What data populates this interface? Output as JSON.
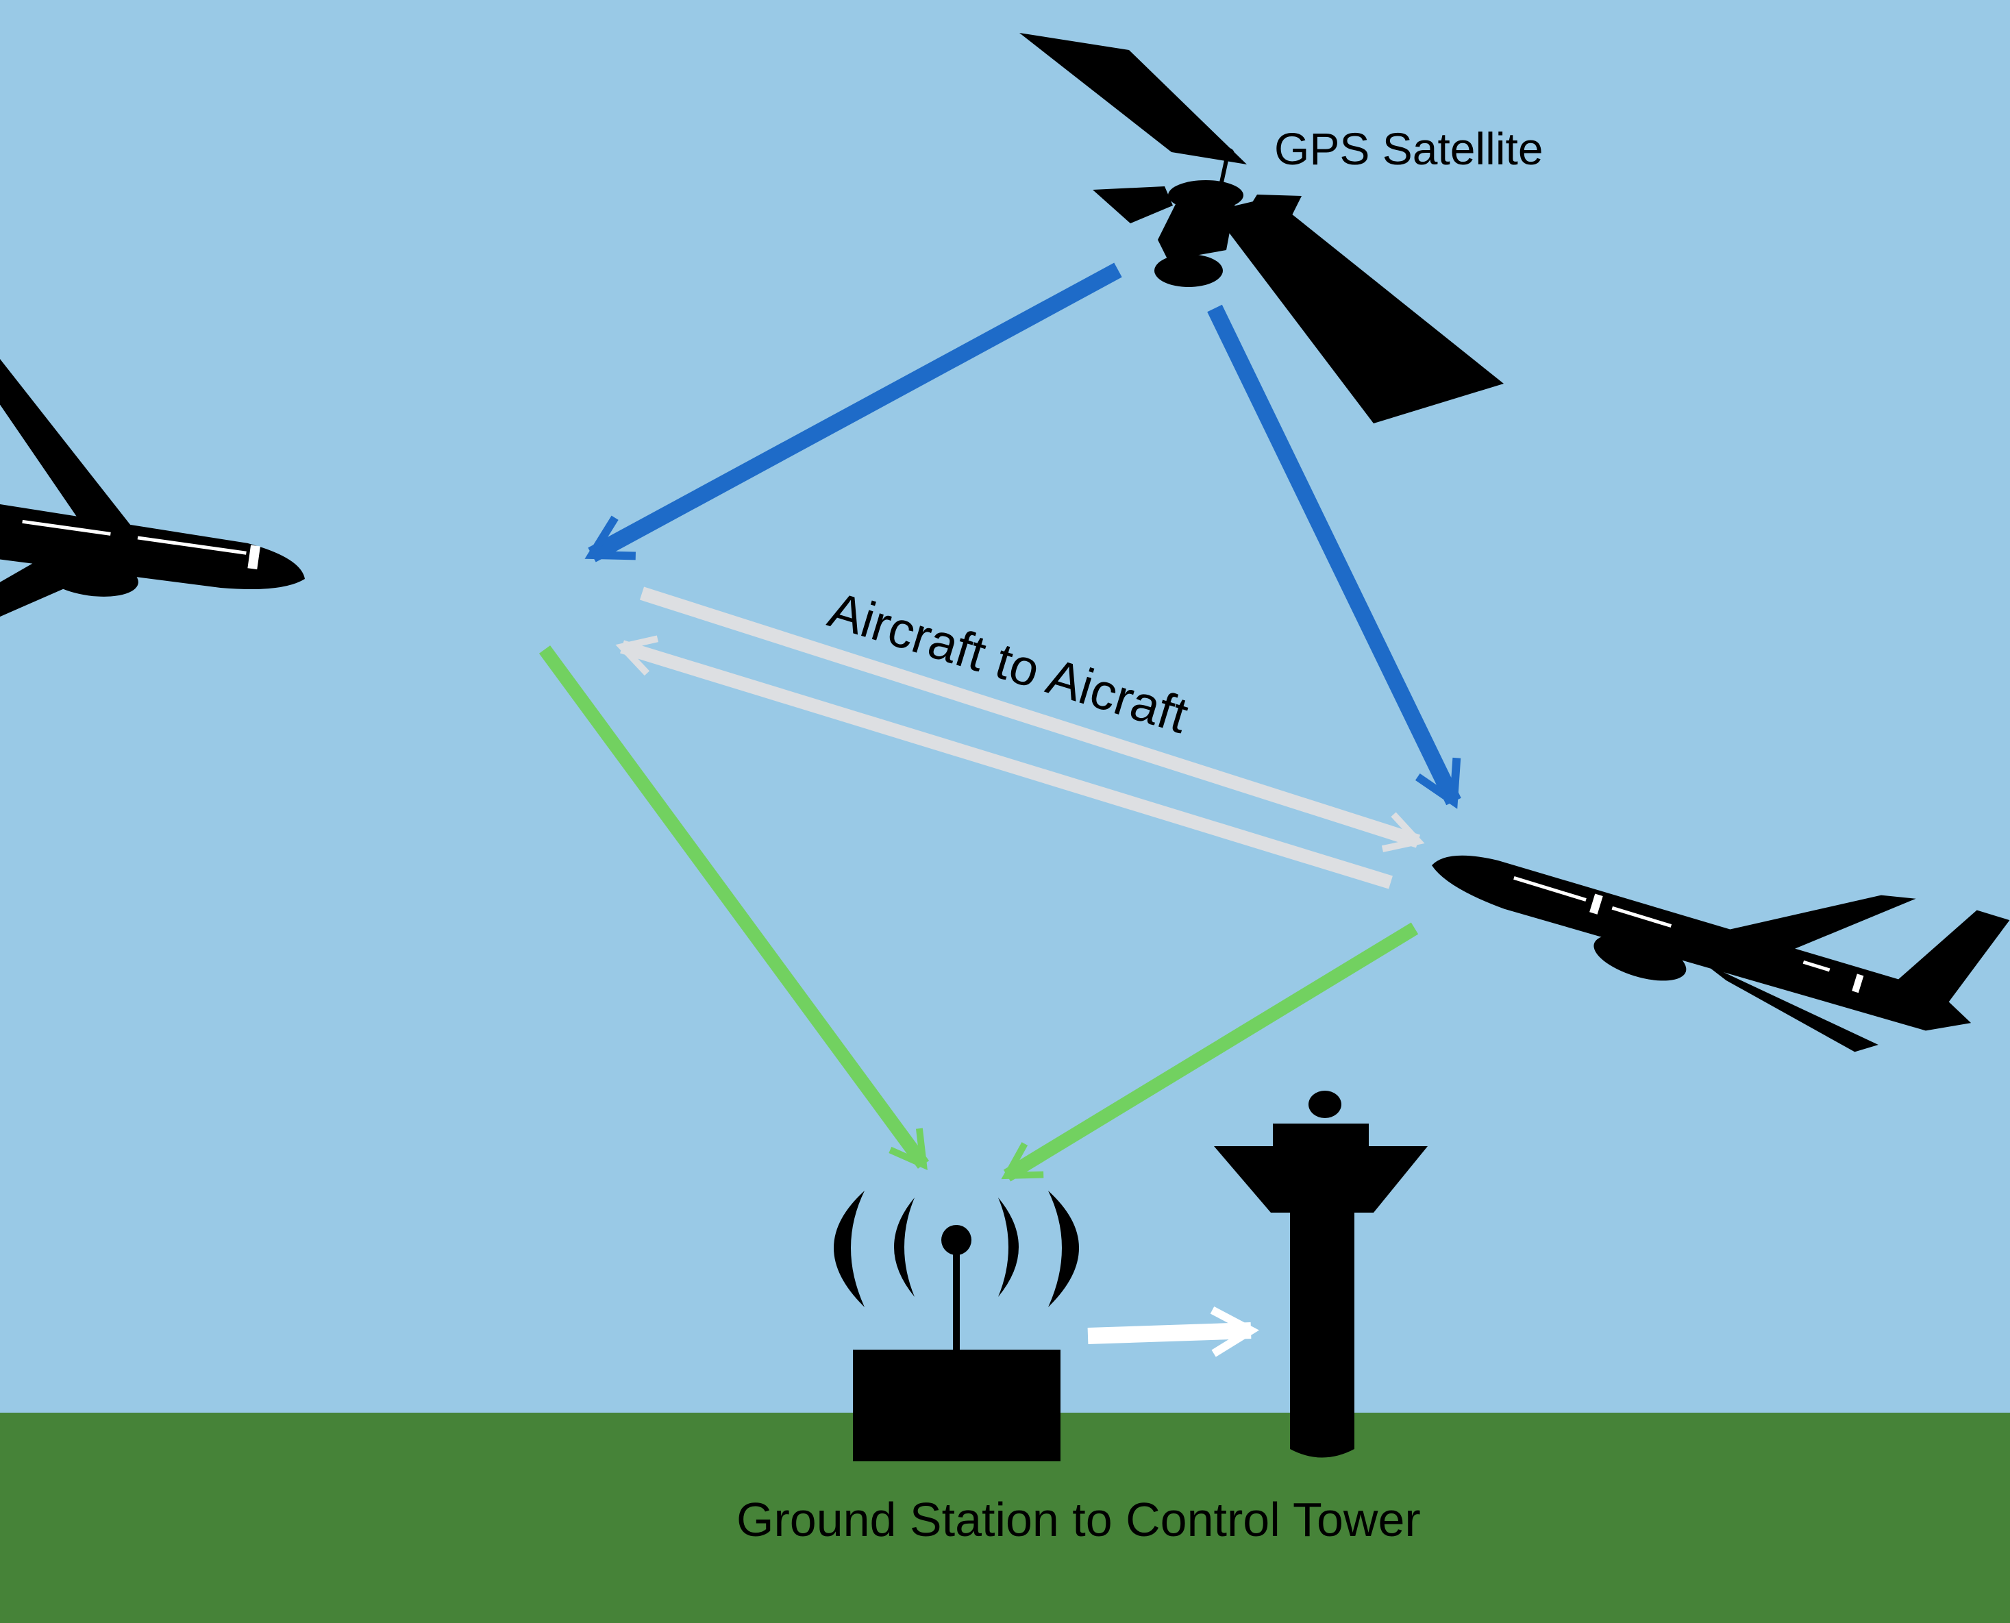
{
  "labels": {
    "satellite": "GPS Satellite",
    "aircraft_link": "Aircraft to Aicraft",
    "ground_link": "Ground Station to Control Tower"
  },
  "colors": {
    "sky": "#99c9e6",
    "ground": "#468338",
    "gps_link": "#1e6bc8",
    "aircraft_link": "#dddfe2",
    "ground_link": "#72d160",
    "tower_link": "#ffffff",
    "silhouette": "#000000"
  },
  "icons": [
    "satellite-icon",
    "airplane-icon",
    "radio-antenna-icon",
    "control-tower-icon"
  ]
}
